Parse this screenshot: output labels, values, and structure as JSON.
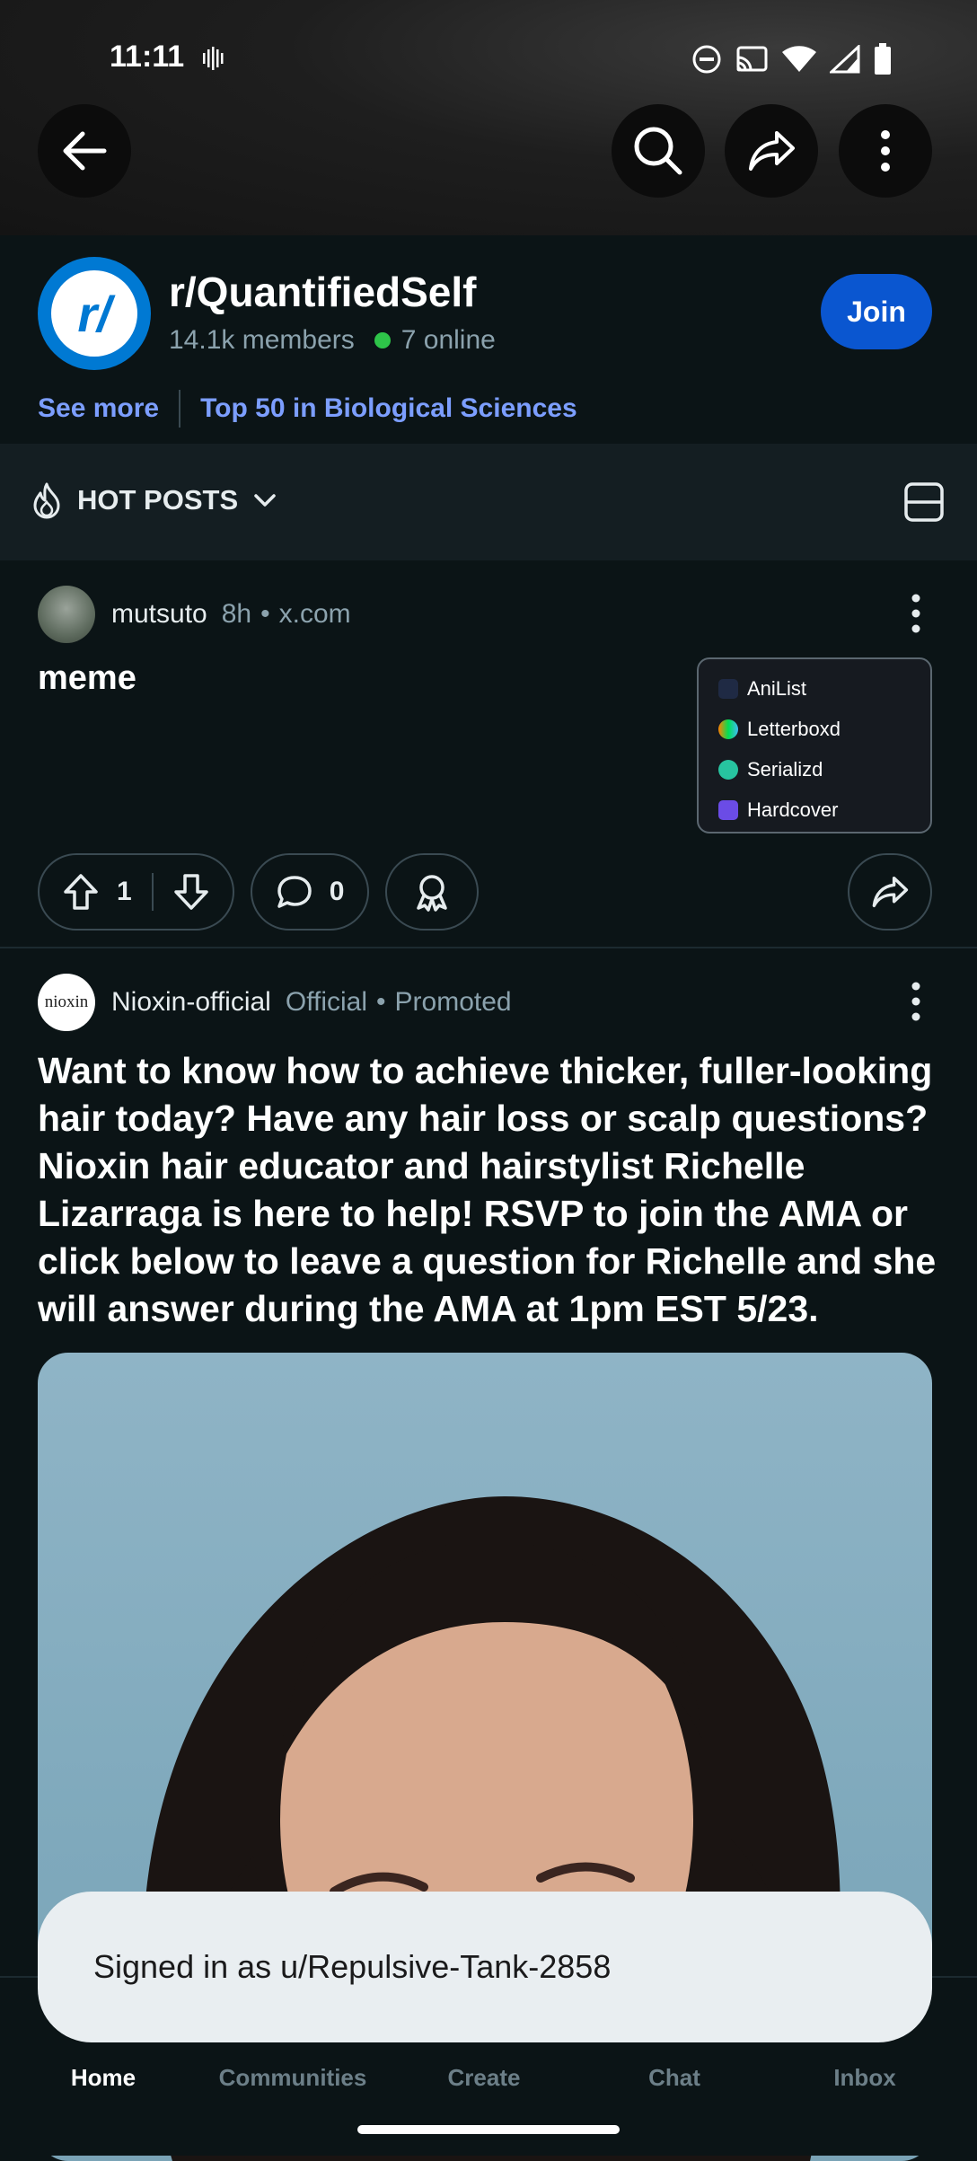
{
  "status_bar": {
    "time": "11:11"
  },
  "community": {
    "name": "r/QuantifiedSelf",
    "avatar_text": "r/",
    "members": "14.1k members",
    "online": "7 online",
    "join_label": "Join",
    "see_more": "See more",
    "ranking": "Top 50 in Biological Sciences"
  },
  "sort": {
    "label": "HOT POSTS"
  },
  "posts": [
    {
      "author": "mutsuto",
      "age": "8h",
      "domain": "x.com",
      "title": "meme",
      "thumbnail_items": [
        "AniList",
        "Letterboxd",
        "Serializd",
        "Hardcover"
      ],
      "upvotes": "1",
      "comments": "0"
    },
    {
      "author": "Nioxin-official",
      "avatar_text": "nioxin",
      "flair": "Official",
      "promoted": "Promoted",
      "title": "Want to know how to achieve thicker, fuller-looking hair today? Have any hair loss or scalp questions? Nioxin hair educator and hairstylist Richelle Lizarraga is here to help! RSVP to join the AMA or click below to leave a question for Richelle and she will answer during the AMA at 1pm EST 5/23."
    }
  ],
  "toast": {
    "text": "Signed in as u/Repulsive-Tank-2858"
  },
  "bottom_nav": [
    {
      "label": "Home"
    },
    {
      "label": "Communities"
    },
    {
      "label": "Create"
    },
    {
      "label": "Chat"
    },
    {
      "label": "Inbox"
    }
  ],
  "colors": {
    "accent": "#0a56d0",
    "link": "#7c9eff",
    "online": "#2ec449",
    "background": "#0b1416"
  }
}
